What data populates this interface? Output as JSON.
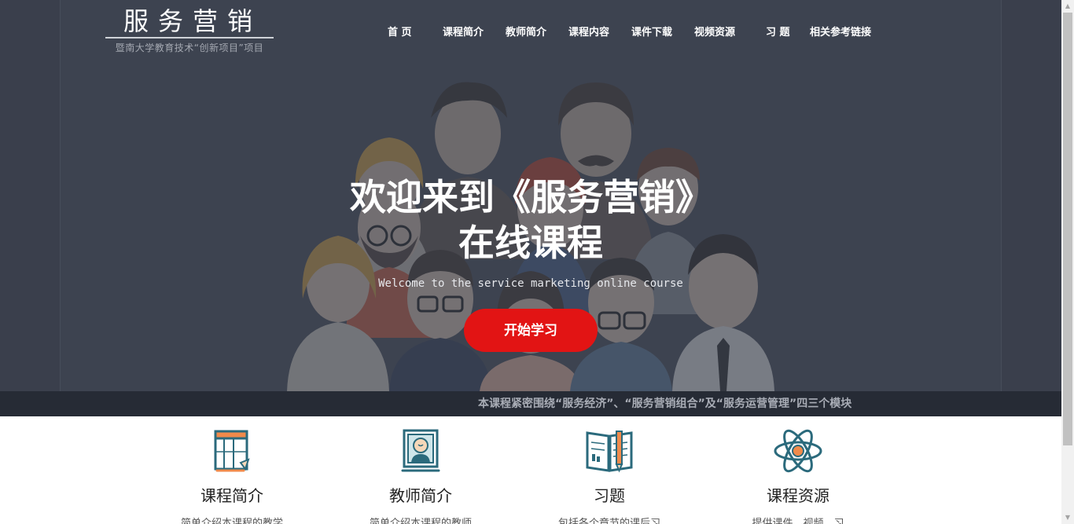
{
  "logo": {
    "title": "服务营销",
    "subtitle": "暨南大学教育技术“创新项目”项目"
  },
  "nav": {
    "items": [
      {
        "label": "首 页"
      },
      {
        "label": "课程简介"
      },
      {
        "label": "教师简介"
      },
      {
        "label": "课程内容"
      },
      {
        "label": "课件下载"
      },
      {
        "label": "视频资源"
      },
      {
        "label": "习 题"
      },
      {
        "label": "相关参考链接"
      }
    ]
  },
  "hero": {
    "title_line1": "欢迎来到《服务营销》",
    "title_line2": "在线课程",
    "subtitle": "Welcome to the service marketing online course",
    "cta_label": "开始学习"
  },
  "ticker": {
    "text": "本课程紧密围绕“服务经济”、“服务营销组合”及“服务运营管理”四三个模块"
  },
  "features": [
    {
      "title": "课程简介",
      "desc": "简单介绍本课程的教学",
      "icon": "course-outline-icon"
    },
    {
      "title": "教师简介",
      "desc": "简单介绍本课程的教师",
      "icon": "teacher-portrait-icon"
    },
    {
      "title": "习题",
      "desc": "包括各个章节的课后习",
      "icon": "notebook-pen-icon"
    },
    {
      "title": "课程资源",
      "desc": "提供课件、视频、习",
      "icon": "atom-icon"
    }
  ],
  "colors": {
    "hero_bg": "#3d4350",
    "cta": "#e21414",
    "ticker_bg": "#262b35",
    "icon_teal": "#2b6a7c",
    "icon_orange": "#f08a4b"
  }
}
